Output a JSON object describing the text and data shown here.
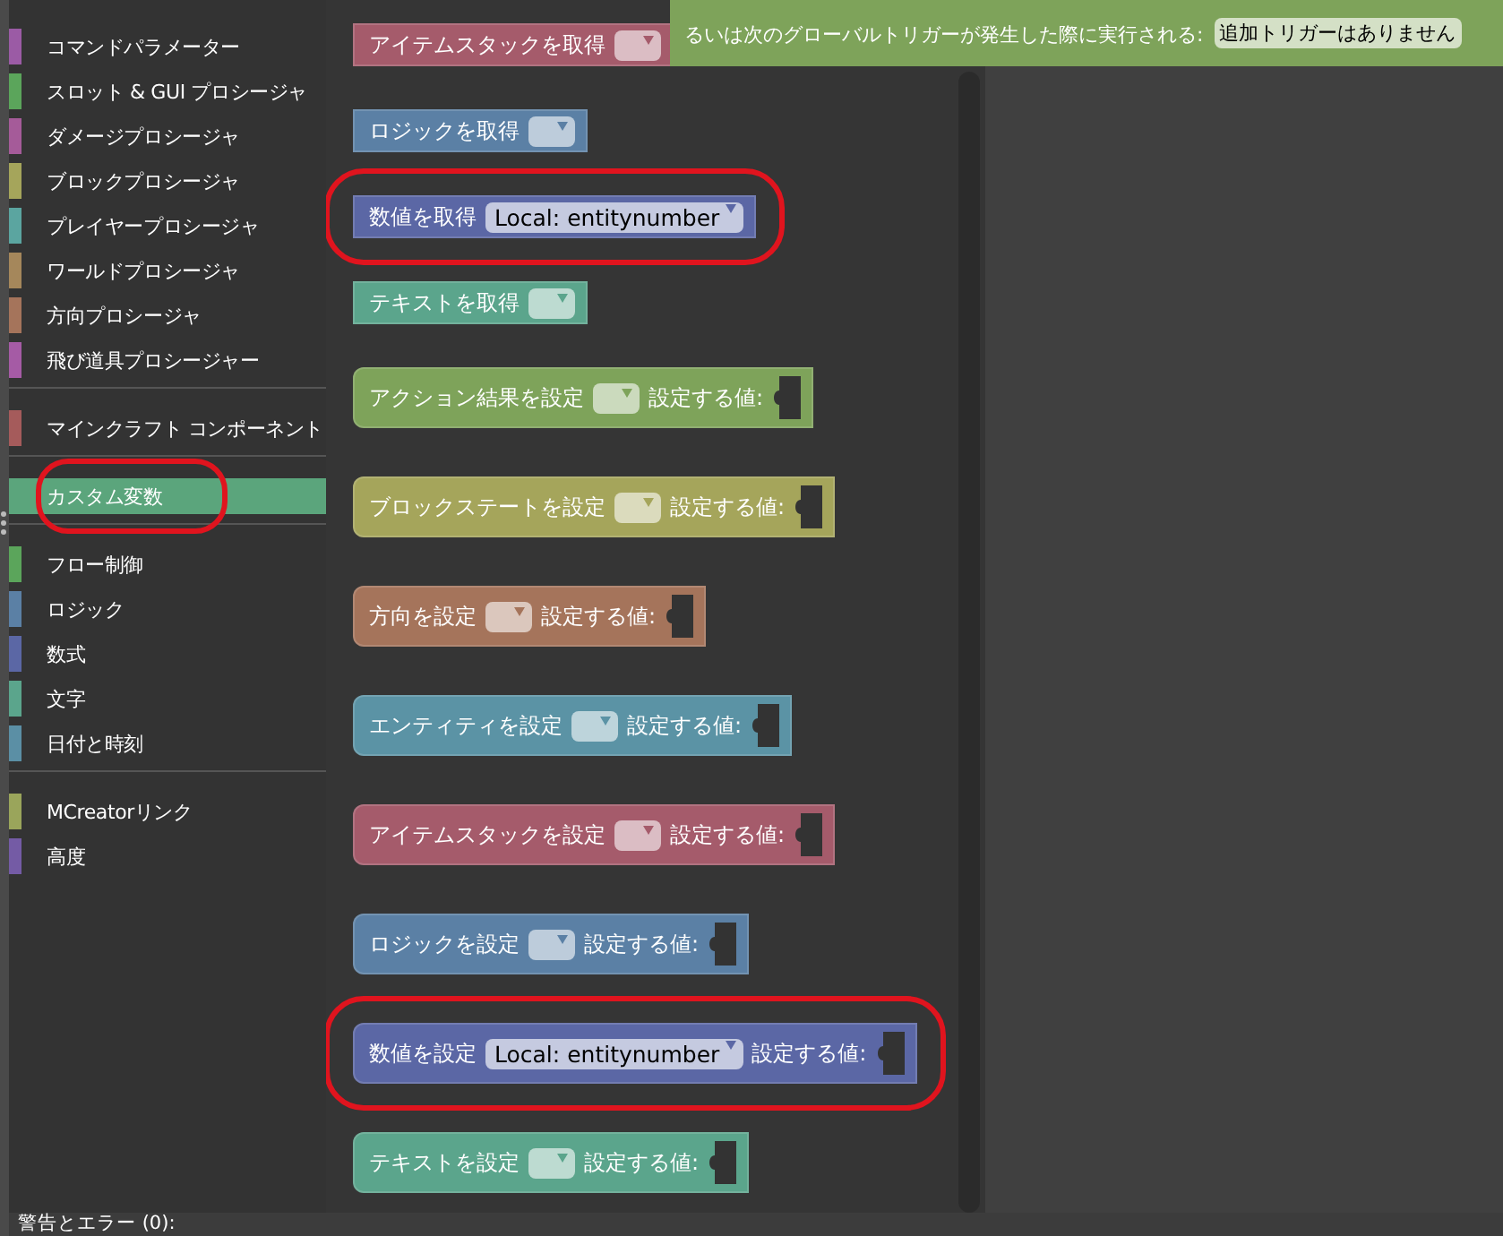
{
  "sidebar": {
    "groups": [
      [
        {
          "label": "コマンドパラメーター",
          "color": "#9b5ba5",
          "selected": false,
          "highlighted": false
        },
        {
          "label": "スロット & GUI プロシージャ",
          "color": "#5ba55b",
          "selected": false,
          "highlighted": false
        },
        {
          "label": "ダメージプロシージャ",
          "color": "#a55b99",
          "selected": false,
          "highlighted": false
        },
        {
          "label": "ブロックプロシージャ",
          "color": "#a5a55b",
          "selected": false,
          "highlighted": false
        },
        {
          "label": "プレイヤープロシージャ",
          "color": "#5ba5a0",
          "selected": false,
          "highlighted": false
        },
        {
          "label": "ワールドプロシージャ",
          "color": "#a5875b",
          "selected": false,
          "highlighted": false
        },
        {
          "label": "方向プロシージャ",
          "color": "#a5745b",
          "selected": false,
          "highlighted": false
        },
        {
          "label": "飛び道具プロシージャー",
          "color": "#a55ba5",
          "selected": false,
          "highlighted": false
        }
      ],
      [
        {
          "label": "マインクラフト コンポーネント",
          "color": "#a55b5b",
          "selected": false,
          "highlighted": false
        }
      ],
      [
        {
          "label": "カスタム変数",
          "color": "#5ba57c",
          "selected": true,
          "highlighted": true
        }
      ],
      [
        {
          "label": "フロー制御",
          "color": "#5ba55b",
          "selected": false,
          "highlighted": false
        },
        {
          "label": "ロジック",
          "color": "#5b80a5",
          "selected": false,
          "highlighted": false
        },
        {
          "label": "数式",
          "color": "#5b67a5",
          "selected": false,
          "highlighted": false
        },
        {
          "label": "文字",
          "color": "#5ba58c",
          "selected": false,
          "highlighted": false
        },
        {
          "label": "日付と時刻",
          "color": "#5b8fa5",
          "selected": false,
          "highlighted": false
        }
      ],
      [
        {
          "label": "MCreatorリンク",
          "color": "#9aa55b",
          "selected": false,
          "highlighted": false
        },
        {
          "label": "高度",
          "color": "#745ba5",
          "selected": false,
          "highlighted": false
        }
      ]
    ]
  },
  "flyout": {
    "blocks": [
      {
        "kind": "get",
        "label": "アイテムスタックを取得",
        "color": "#a55b6b",
        "highlighted": false
      },
      {
        "kind": "get",
        "label": "ロジックを取得",
        "color": "#5b80a5",
        "highlighted": false
      },
      {
        "kind": "get",
        "label": "数値を取得",
        "color": "#5b67a5",
        "dropdown": "Local: entitynumber",
        "highlighted": true
      },
      {
        "kind": "get",
        "label": "テキストを取得",
        "color": "#5ba58c",
        "highlighted": false
      },
      {
        "kind": "set",
        "label": "アクション結果を設定",
        "color": "#7ea35a",
        "value_label": "設定する値:",
        "highlighted": false
      },
      {
        "kind": "set",
        "label": "ブロックステートを設定",
        "color": "#a5a55b",
        "value_label": "設定する値:",
        "highlighted": false
      },
      {
        "kind": "set",
        "label": "方向を設定",
        "color": "#a5745b",
        "value_label": "設定する値:",
        "highlighted": false
      },
      {
        "kind": "set",
        "label": "エンティティを設定",
        "color": "#5b93a5",
        "value_label": "設定する値:",
        "highlighted": false
      },
      {
        "kind": "set",
        "label": "アイテムスタックを設定",
        "color": "#a55b6b",
        "value_label": "設定する値:",
        "highlighted": false
      },
      {
        "kind": "set",
        "label": "ロジックを設定",
        "color": "#5b80a5",
        "value_label": "設定する値:",
        "highlighted": false
      },
      {
        "kind": "set",
        "label": "数値を設定",
        "color": "#5b67a5",
        "dropdown": "Local: entitynumber",
        "value_label": "設定する値:",
        "highlighted": true
      },
      {
        "kind": "set",
        "label": "テキストを設定",
        "color": "#5ba58c",
        "value_label": "設定する値:",
        "highlighted": false
      }
    ]
  },
  "workspace": {
    "trigger_block": {
      "text": "るいは次のグローバルトリガーが発生した際に実行される:",
      "chip": "追加トリガーはありません"
    }
  },
  "status_bar": {
    "text": "警告とエラー (0):"
  }
}
